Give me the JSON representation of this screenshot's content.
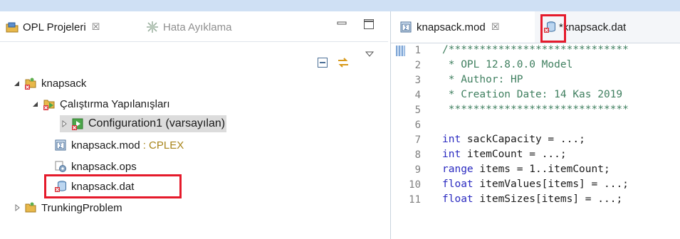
{
  "left_view": {
    "tabs": [
      {
        "label": "OPL Projeleri",
        "close": "☒",
        "icon": "opl-projects-icon",
        "active": true
      },
      {
        "label": "Hata Ayıklama",
        "icon": "debug-icon",
        "active": false
      }
    ],
    "tree": [
      {
        "label": "knapsack",
        "icon": "project-icon",
        "expanded": true
      },
      {
        "label": "Çalıştırma Yapılanışları",
        "icon": "run-configs-icon",
        "expanded": true
      },
      {
        "label": "Configuration1 (varsayılan)",
        "icon": "configuration-icon",
        "expanded": false,
        "selected": true
      },
      {
        "label": "knapsack.mod",
        "suffix": ": CPLEX",
        "icon": "model-file-icon"
      },
      {
        "label": "knapsack.ops",
        "icon": "settings-file-icon"
      },
      {
        "label": "knapsack.dat",
        "icon": "data-file-icon",
        "highlighted": true
      },
      {
        "label": "TrunkingProblem",
        "icon": "project-icon",
        "expanded": false
      }
    ]
  },
  "editor": {
    "tabs": [
      {
        "label": "knapsack.mod",
        "close": "☒",
        "active": true
      },
      {
        "label": "*knapsack.dat",
        "active": false
      }
    ],
    "lines": [
      {
        "n": "1",
        "text": "/*****************************"
      },
      {
        "n": "2",
        "text": " * OPL 12.8.0.0 Model"
      },
      {
        "n": "3",
        "text": " * Author: HP"
      },
      {
        "n": "4",
        "text": " * Creation Date: 14 Kas 2019"
      },
      {
        "n": "5",
        "text": " *****************************"
      },
      {
        "n": "6",
        "text": ""
      },
      {
        "n": "7",
        "kw": "int",
        "rest": " sackCapacity = ...;"
      },
      {
        "n": "8",
        "kw": "int",
        "rest": " itemCount = ...;"
      },
      {
        "n": "9",
        "kw": "range",
        "rest": " items = 1..itemCount;"
      },
      {
        "n": "10",
        "kw": "float",
        "rest": " itemValues[items] = ...;"
      },
      {
        "n": "11",
        "kw": "float",
        "rest": " itemSizes[items] = ...;"
      }
    ]
  },
  "colors": {
    "highlight_box": "#e51a2b",
    "comment": "#3f7f5f",
    "keyword": "#7f0055",
    "selection": "#d9d9d9"
  }
}
